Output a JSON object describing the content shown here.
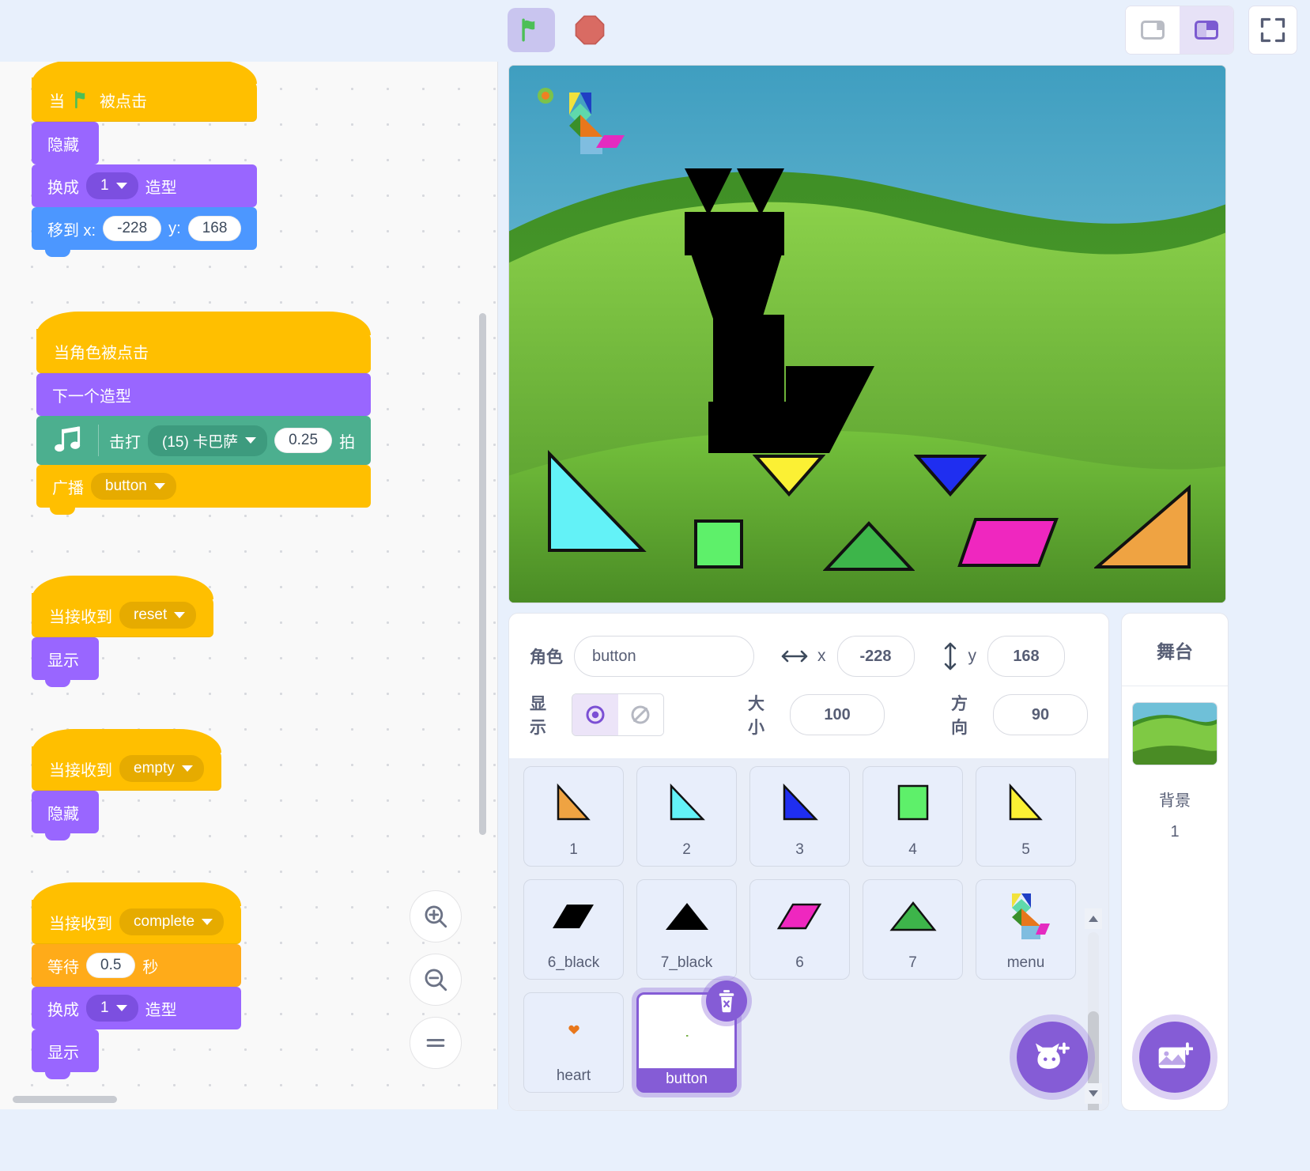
{
  "toolbar": {
    "green_flag_icon": "green-flag-icon",
    "stop_icon": "stop-sign-icon",
    "layout_small_icon": "layout-small-stage-icon",
    "layout_large_icon": "layout-large-stage-icon",
    "fullscreen_icon": "fullscreen-icon"
  },
  "code": {
    "scripts": [
      {
        "id": "script-flag",
        "blocks": [
          {
            "type": "hat",
            "category": "events",
            "text": "当",
            "flag": true,
            "text2": "被点击"
          },
          {
            "type": "stack",
            "category": "looks",
            "text": "隐藏"
          },
          {
            "type": "stack",
            "category": "looks",
            "text": "换成",
            "dropdown": "1",
            "text2": "造型"
          },
          {
            "type": "stack",
            "category": "motion",
            "text": "移到 x:",
            "value": "-228",
            "text2": "y:",
            "value2": "168"
          }
        ]
      },
      {
        "id": "script-sprite-clicked",
        "blocks": [
          {
            "type": "hat",
            "category": "events",
            "text": "当角色被点击"
          },
          {
            "type": "stack",
            "category": "looks",
            "text": "下一个造型"
          },
          {
            "type": "stack",
            "category": "music",
            "text": "击打",
            "dropdown": "(15) 卡巴萨",
            "value": "0.25",
            "text2": "拍"
          },
          {
            "type": "stack",
            "category": "events",
            "text": "广播",
            "dropdown": "button"
          }
        ]
      },
      {
        "id": "script-reset",
        "blocks": [
          {
            "type": "hat",
            "category": "events",
            "text": "当接收到",
            "dropdown": "reset"
          },
          {
            "type": "stack",
            "category": "looks",
            "text": "显示"
          }
        ]
      },
      {
        "id": "script-empty",
        "blocks": [
          {
            "type": "hat",
            "category": "events",
            "text": "当接收到",
            "dropdown": "empty"
          },
          {
            "type": "stack",
            "category": "looks",
            "text": "隐藏"
          }
        ]
      },
      {
        "id": "script-complete",
        "blocks": [
          {
            "type": "hat",
            "category": "events",
            "text": "当接收到",
            "dropdown": "complete"
          },
          {
            "type": "stack",
            "category": "control",
            "text": "等待",
            "value": "0.5",
            "text2": "秒"
          },
          {
            "type": "stack",
            "category": "looks",
            "text": "换成",
            "dropdown": "1",
            "text2": "造型"
          },
          {
            "type": "stack",
            "category": "looks",
            "text": "显示"
          }
        ]
      }
    ],
    "zoom_in_icon": "zoom-in-icon",
    "zoom_out_icon": "zoom-out-icon",
    "zoom_reset_icon": "zoom-reset-icon"
  },
  "sprite_info": {
    "name_label": "角色",
    "name_value": "button",
    "x_label": "x",
    "x_value": "-228",
    "y_label": "y",
    "y_value": "168",
    "show_label": "显示",
    "size_label": "大小",
    "size_value": "100",
    "direction_label": "方向",
    "direction_value": "90",
    "visible_icon": "eye-show-icon",
    "hidden_icon": "eye-hide-icon"
  },
  "sprites": [
    {
      "name": "1",
      "shape": "triangle-right-orange"
    },
    {
      "name": "2",
      "shape": "triangle-right-cyan"
    },
    {
      "name": "3",
      "shape": "triangle-right-blue"
    },
    {
      "name": "4",
      "shape": "square-green"
    },
    {
      "name": "5",
      "shape": "triangle-right-yellow"
    },
    {
      "name": "6_black",
      "shape": "parallelogram-black"
    },
    {
      "name": "7_black",
      "shape": "triangle-up-black"
    },
    {
      "name": "6",
      "shape": "parallelogram-magenta"
    },
    {
      "name": "7",
      "shape": "triangle-up-green"
    },
    {
      "name": "menu",
      "shape": "tangram-cat-menu"
    },
    {
      "name": "heart",
      "shape": "heart-tiny"
    },
    {
      "name": "button",
      "shape": "blank-white",
      "selected": true
    }
  ],
  "sprite_list": {
    "delete_icon": "trash-delete-icon",
    "add_sprite_icon": "add-sprite-cat-icon",
    "scroll_up_icon": "scroll-up-arrow-icon",
    "scroll_down_icon": "scroll-down-arrow-icon"
  },
  "stage_panel": {
    "title": "舞台",
    "backdrop_label": "背景",
    "backdrop_count": "1",
    "add_backdrop_icon": "add-backdrop-image-icon"
  },
  "stage_shapes": [
    {
      "name": "tangram-cat-silhouette"
    },
    {
      "name": "tangram-cat-mini-preview"
    },
    {
      "name": "triangle-cyan"
    },
    {
      "name": "square-green"
    },
    {
      "name": "triangle-yellow-down"
    },
    {
      "name": "triangle-blue-down"
    },
    {
      "name": "triangle-green-up"
    },
    {
      "name": "parallelogram-magenta"
    },
    {
      "name": "triangle-orange"
    }
  ],
  "colors": {
    "events": "#ffbf00",
    "looks": "#9966ff",
    "motion": "#4c97ff",
    "control": "#ffab19",
    "music": "#4caf8f",
    "accent": "#855cd6"
  }
}
